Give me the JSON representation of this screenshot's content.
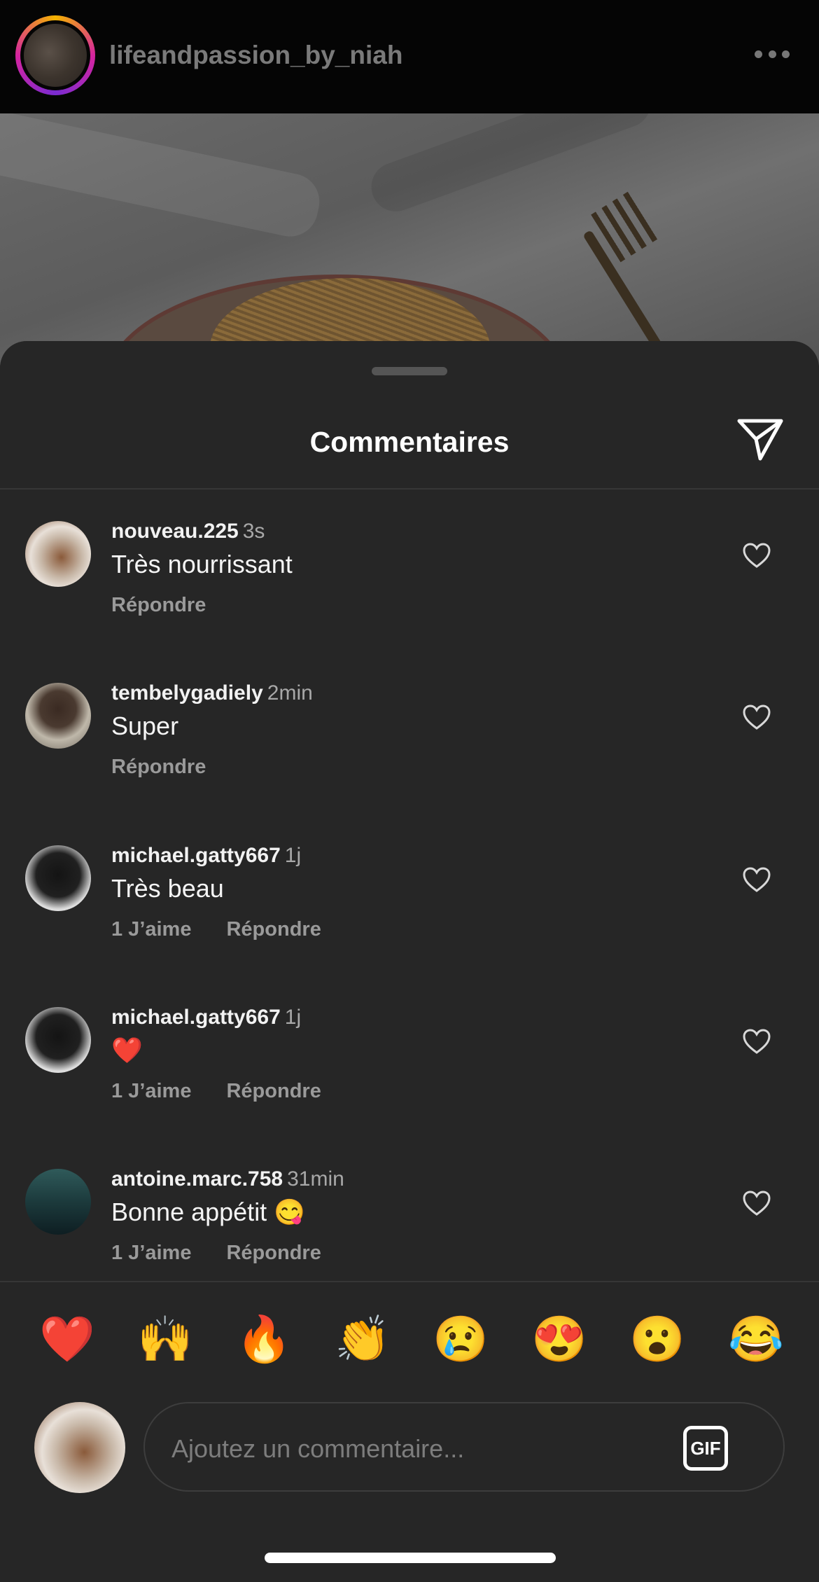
{
  "post_header": {
    "username": "lifeandpassion_by_niah",
    "more_icon": "ellipsis-icon"
  },
  "sheet": {
    "title": "Commentaires",
    "share_icon": "paper-plane-icon"
  },
  "comments": [
    {
      "username": "nouveau.225",
      "time": "3s",
      "text": "Très nourrissant",
      "likes": "",
      "reply": "Répondre"
    },
    {
      "username": "tembelygadiely",
      "time": "2min",
      "text": "Super",
      "likes": "",
      "reply": "Répondre"
    },
    {
      "username": "michael.gatty667",
      "time": "1j",
      "text": "Très beau",
      "likes": "1 J’aime",
      "reply": "Répondre"
    },
    {
      "username": "michael.gatty667",
      "time": "1j",
      "text": "❤️",
      "likes": "1 J’aime",
      "reply": "Répondre"
    },
    {
      "username": "antoine.marc.758",
      "time": "31min",
      "text": "Bonne appétit 😋",
      "likes": "1 J’aime",
      "reply": "Répondre"
    }
  ],
  "quick_reactions": [
    "❤️",
    "🙌",
    "🔥",
    "👏",
    "😢",
    "😍",
    "😮",
    "😂"
  ],
  "composer": {
    "placeholder": "Ajoutez un commentaire...",
    "gif_label": "GIF"
  },
  "colors": {
    "background": "#262626",
    "text": "#ffffff",
    "secondary": "#a8a8a8",
    "divider": "#363636"
  }
}
